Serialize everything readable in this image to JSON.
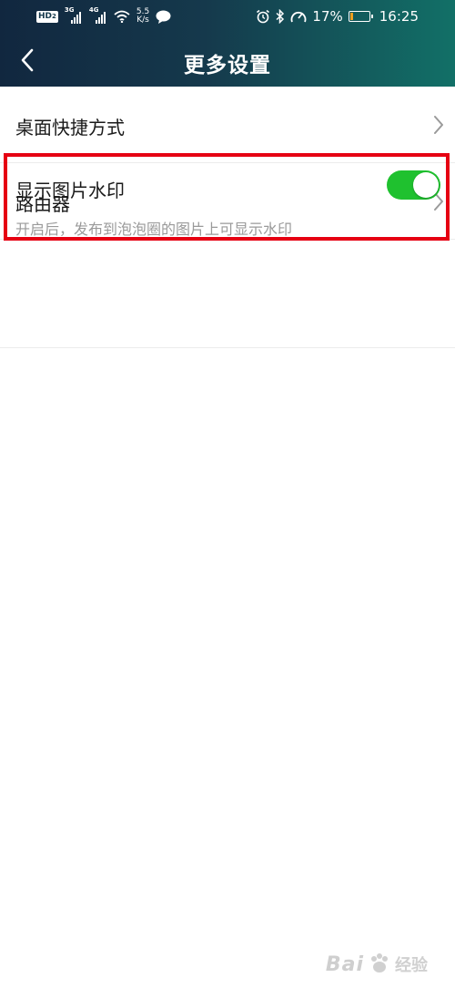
{
  "status_bar": {
    "hd_label": "HD",
    "hd_sub": "2",
    "signal1_gen": "3G",
    "signal2_gen": "4G",
    "speed_value": "5.5",
    "speed_unit": "K/s",
    "battery_text": "17%",
    "battery_level": 0.17,
    "time": "16:25",
    "icons": [
      "wifi-icon",
      "chat-bubble-icon",
      "alarm-icon",
      "bluetooth-icon",
      "gauge-icon",
      "battery-icon"
    ]
  },
  "nav": {
    "title": "更多设置",
    "back_icon": "chevron-left-icon"
  },
  "settings": {
    "items": [
      {
        "label": "桌面快捷方式",
        "icon": "chevron-right-icon"
      },
      {
        "label": "路由器",
        "icon": "chevron-right-icon"
      }
    ],
    "watermark_toggle": {
      "label": "显示图片水印",
      "description": "开启后，发布到泡泡圈的图片上可显示水印",
      "enabled": true
    }
  },
  "colors": {
    "header_start": "#11273f",
    "header_end": "#127067",
    "toggle_on": "#1fc12f",
    "highlight": "#e60012"
  },
  "watermark": {
    "brand": "Bai",
    "brand_sub": "经验"
  }
}
